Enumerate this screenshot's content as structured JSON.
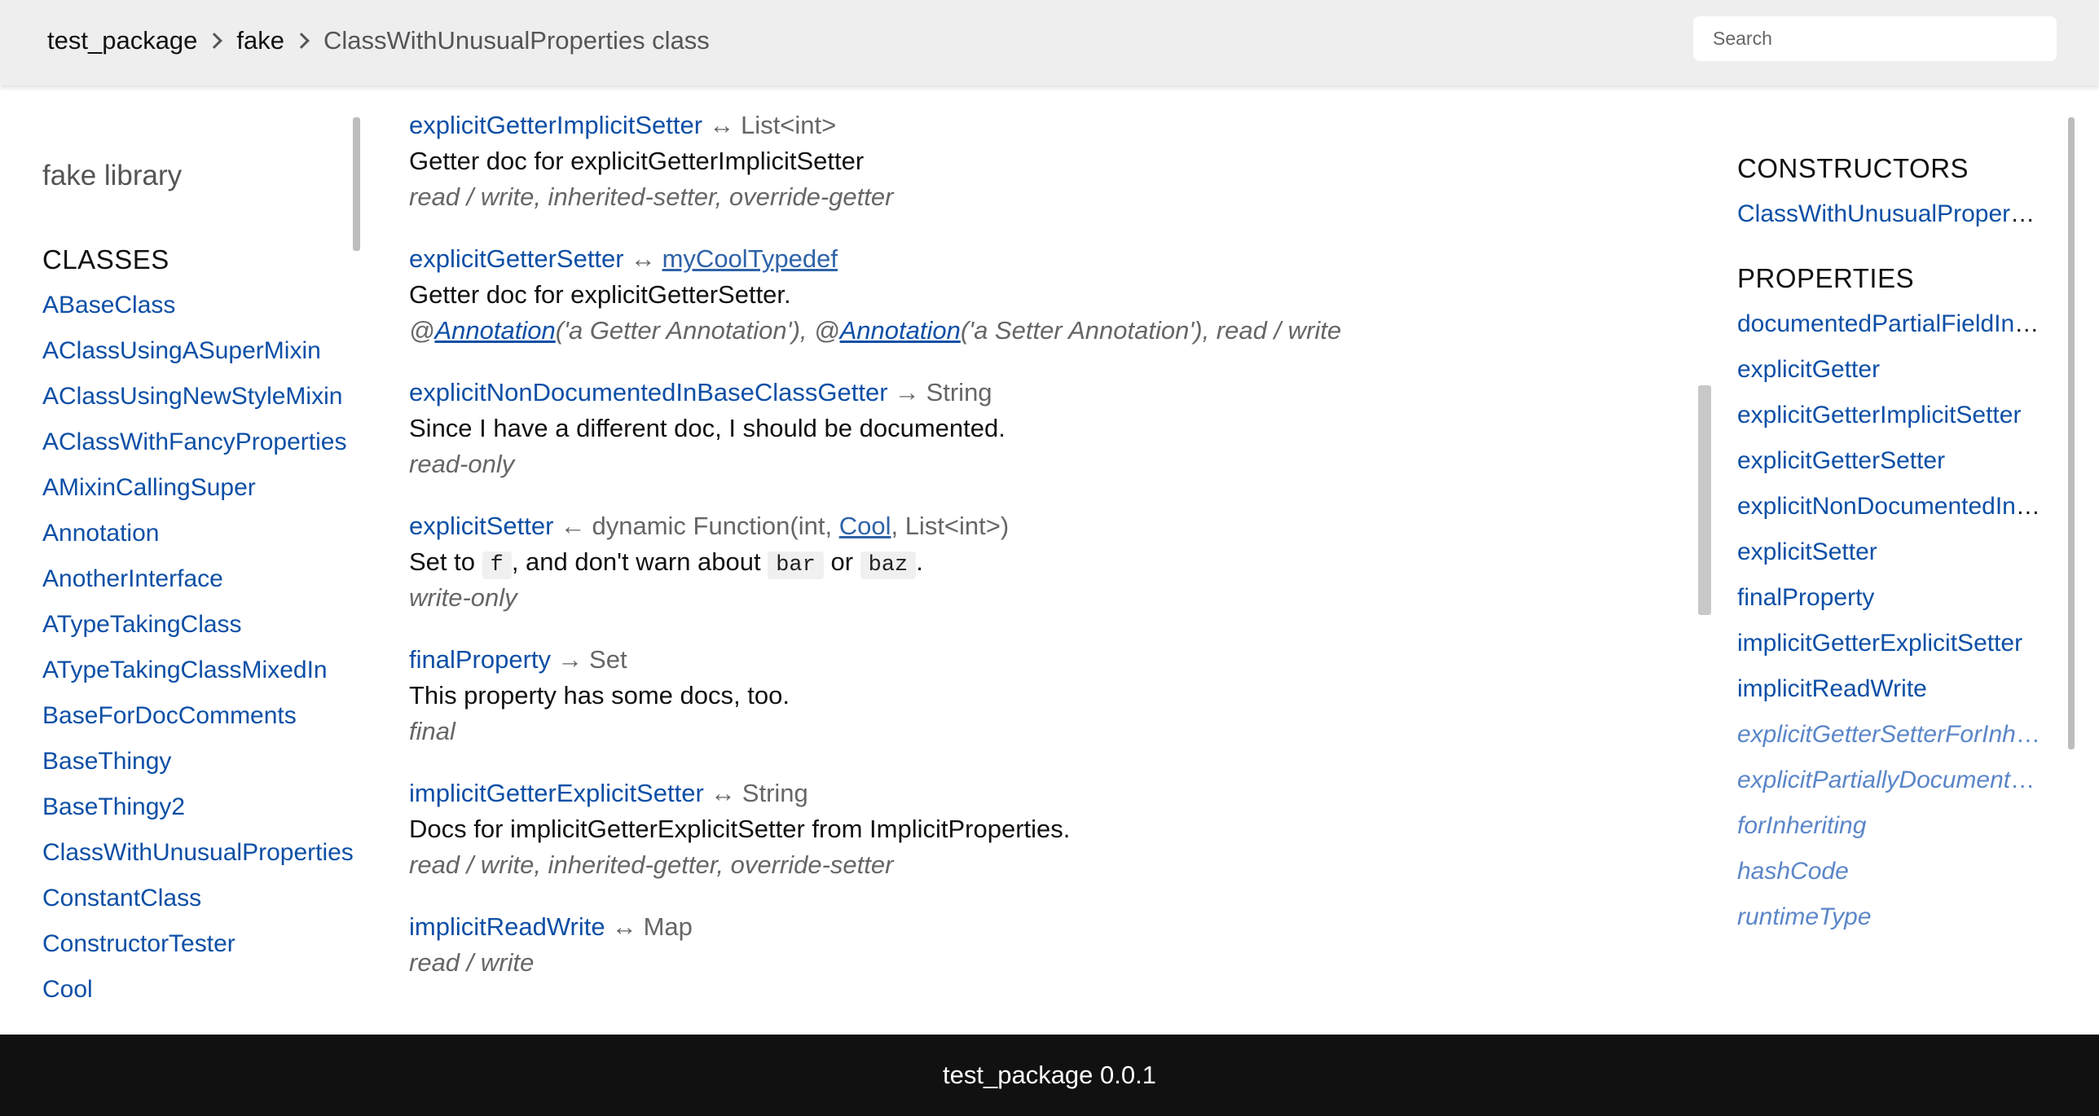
{
  "header": {
    "breadcrumb": [
      "test_package",
      "fake",
      "ClassWithUnusualProperties class"
    ],
    "search_placeholder": "Search"
  },
  "left_sidebar": {
    "library_title": "fake library",
    "classes_heading": "CLASSES",
    "classes": [
      "ABaseClass",
      "AClassUsingASuperMixin",
      "AClassUsingNewStyleMixin",
      "AClassWithFancyProperties",
      "AMixinCallingSuper",
      "Annotation",
      "AnotherInterface",
      "ATypeTakingClass",
      "ATypeTakingClassMixedIn",
      "BaseForDocComments",
      "BaseThingy",
      "BaseThingy2",
      "ClassWithUnusualProperties",
      "ConstantClass",
      "ConstructorTester",
      "Cool"
    ]
  },
  "main": {
    "properties": [
      {
        "name": "explicitGetterImplicitSetter",
        "symbol": "↔",
        "type": "List<int>",
        "doc": "Getter doc for explicitGetterImplicitSetter",
        "meta": "read / write, inherited-setter, override-getter"
      },
      {
        "name": "explicitGetterSetter",
        "symbol": "↔",
        "type_link": "myCoolTypedef",
        "doc": "Getter doc for explicitGetterSetter.",
        "meta_parts": [
          "@",
          "Annotation",
          "('a Getter Annotation'), @",
          "Annotation",
          "('a Setter Annotation'), read / write"
        ]
      },
      {
        "name": "explicitNonDocumentedInBaseClassGetter",
        "symbol": "→",
        "type": "String",
        "doc": "Since I have a different doc, I should be documented.",
        "meta": "read-only"
      },
      {
        "name": "explicitSetter",
        "symbol": "←",
        "type_parts": [
          "dynamic Function(int, ",
          "Cool",
          ", List<int>)"
        ],
        "doc_parts": [
          "Set to ",
          "f",
          ", and don't warn about ",
          "bar",
          " or ",
          "baz",
          "."
        ],
        "meta": "write-only"
      },
      {
        "name": "finalProperty",
        "symbol": "→",
        "type": "Set",
        "doc": "This property has some docs, too.",
        "meta": "final"
      },
      {
        "name": "implicitGetterExplicitSetter",
        "symbol": "↔",
        "type": "String",
        "doc": "Docs for implicitGetterExplicitSetter from ImplicitProperties.",
        "meta": "read / write, inherited-getter, override-setter"
      },
      {
        "name": "implicitReadWrite",
        "symbol": "↔",
        "type": "Map",
        "meta": "read / write"
      }
    ]
  },
  "right_sidebar": {
    "constructors_heading": "CONSTRUCTORS",
    "constructors": [
      "ClassWithUnusualProperties"
    ],
    "properties_heading": "PROPERTIES",
    "properties": [
      "documentedPartialFieldInSubclassOnly",
      "explicitGetter",
      "explicitGetterImplicitSetter",
      "explicitGetterSetter",
      "explicitNonDocumentedInBaseClassGetter",
      "explicitSetter",
      "finalProperty",
      "implicitGetterExplicitSetter",
      "implicitReadWrite"
    ],
    "inherited_properties": [
      "explicitGetterSetterForInheriting",
      "explicitPartiallyDocumentedField",
      "forInheriting",
      "hashCode",
      "runtimeType"
    ]
  },
  "footer": {
    "text": "test_package 0.0.1"
  }
}
